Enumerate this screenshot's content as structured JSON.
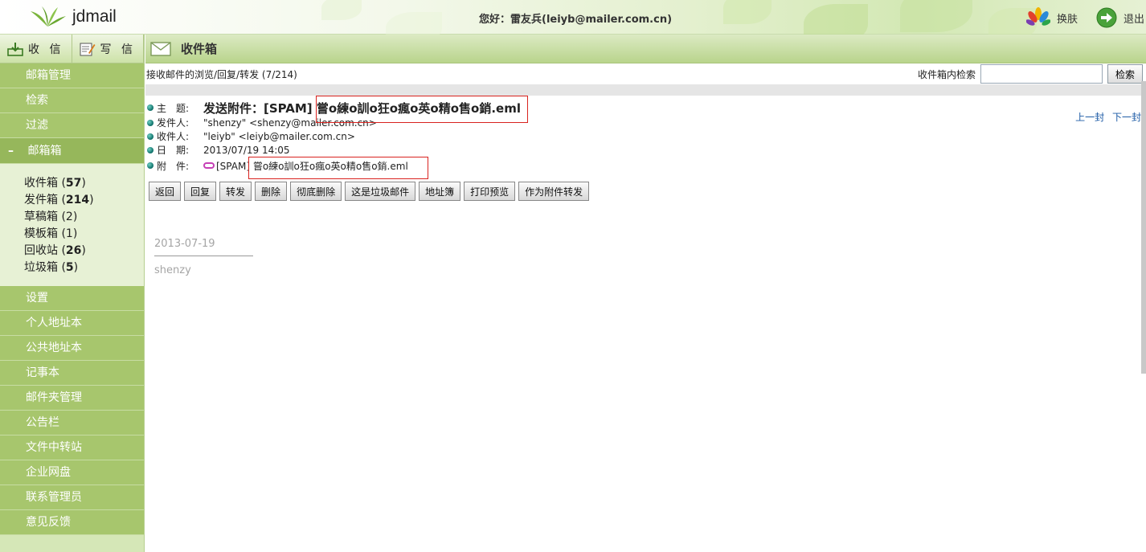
{
  "header": {
    "logo_text": "jdmail",
    "greeting": "您好：雷友兵(leiyb@mailer.com.cn)",
    "skin_label": "换肤",
    "logout_label": "退出"
  },
  "sidebar": {
    "receive_label": "收 信",
    "compose_label": "写 信",
    "top_items": [
      "邮箱管理",
      "检索",
      "过滤"
    ],
    "mailbox_header": "邮箱箱",
    "mailbox_minus": "–",
    "folders": [
      {
        "name": "收件箱",
        "count": "57",
        "bold": true
      },
      {
        "name": "发件箱",
        "count": "214",
        "bold": true
      },
      {
        "name": "草稿箱",
        "count": "2",
        "bold": false
      },
      {
        "name": "模板箱",
        "count": "1",
        "bold": false
      },
      {
        "name": "回收站",
        "count": "26",
        "bold": true
      },
      {
        "name": "垃圾箱",
        "count": "5",
        "bold": true
      }
    ],
    "bottom_items": [
      "设置",
      "个人地址本",
      "公共地址本",
      "记事本",
      "邮件夹管理",
      "公告栏",
      "文件中转站",
      "企业网盘",
      "联系管理员",
      "意见反馈"
    ]
  },
  "main": {
    "title": "收件箱",
    "crumb": "接收邮件的浏览/回复/转发 (7/214)",
    "search_label": "收件箱内检索",
    "search_value": "",
    "search_button": "检索",
    "prev_label": "上一封",
    "next_label": "下一封",
    "headers": {
      "subject_label": "主　题:",
      "subject_value": "发送附件：[SPAM] 嘗o練o訓o狂o瘋o英o精o售o銷.eml",
      "from_label": "发件人:",
      "from_value": "\"shenzy\" <shenzy@mailer.com.cn>",
      "to_label": "收件人:",
      "to_value": "\"leiyb\" <leiyb@mailer.com.cn>",
      "date_label": "日　期:",
      "date_value": "2013/07/19 14:05",
      "attach_label": "附　件:",
      "attach_value": "[SPAM] 嘗o練o訓o狂o瘋o英o精o售o銷.eml"
    },
    "actions": [
      "返回",
      "回复",
      "转发",
      "删除",
      "彻底删除",
      "这是垃圾邮件",
      "地址簿",
      "打印预览",
      "作为附件转发"
    ],
    "body_date": "2013-07-19",
    "body_sender": "shenzy"
  },
  "colors": {
    "sidebar_item": "#a7c66d",
    "sidebar_bg": "#d5e7b7",
    "link": "#1d5ba6",
    "highlight_box": "#d9231f"
  }
}
